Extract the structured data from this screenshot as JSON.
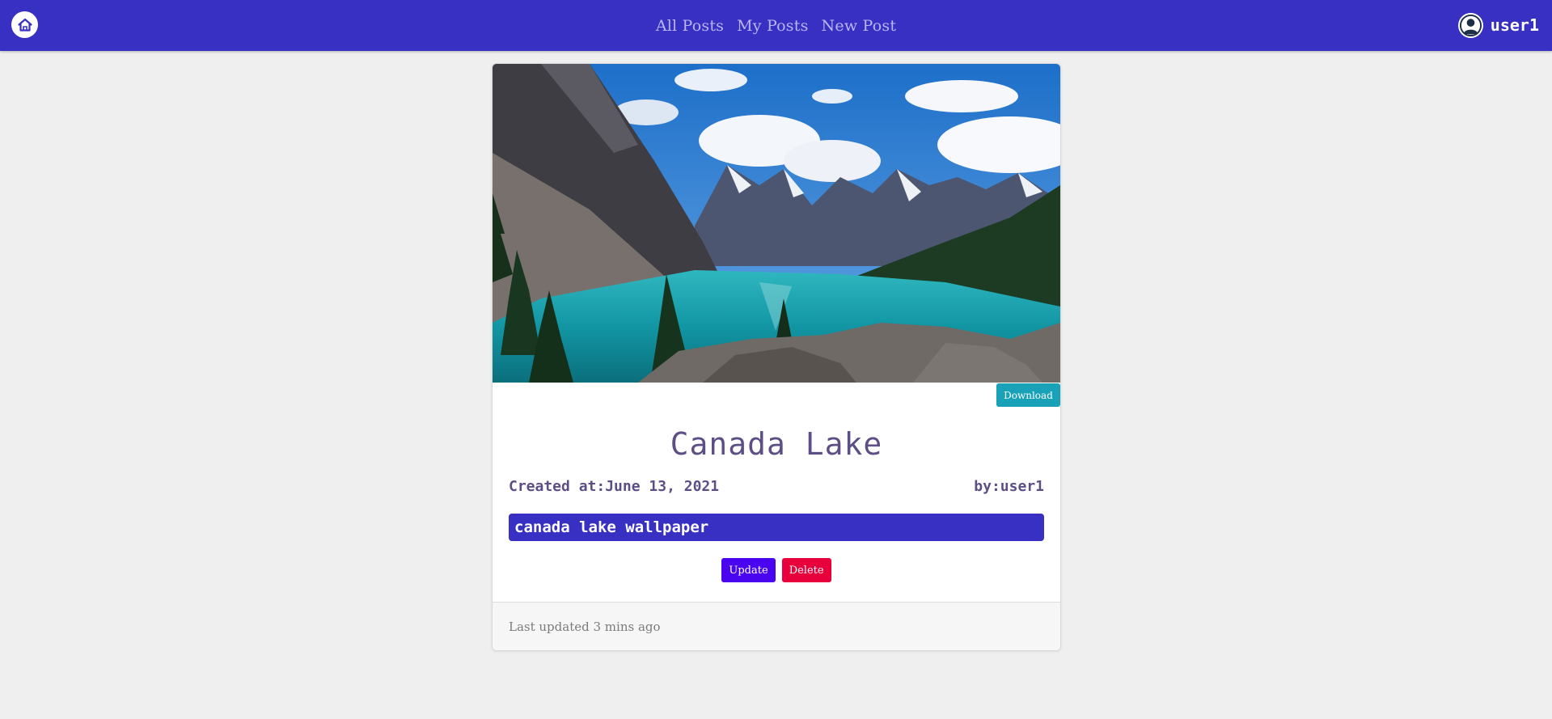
{
  "nav": {
    "home_icon": "home-icon",
    "links": [
      "All Posts",
      "My Posts",
      "New Post"
    ],
    "user_icon": "user-circle-icon",
    "username": "user1",
    "bar_color": "#3730c2"
  },
  "post": {
    "image_alt": "mountain lake landscape photo",
    "download_label": "Download",
    "title": "Canada Lake",
    "created_label": "Created at:June 13, 2021",
    "author_label": "by:user1",
    "description": "canada lake wallpaper",
    "update_label": "Update",
    "delete_label": "Delete",
    "footer_text": "Last updated 3 mins ago"
  },
  "colors": {
    "accent": "#3730c2",
    "update": "#4a05f0",
    "delete": "#e8003d",
    "download": "#19a1b8",
    "title_text": "#5d4f86"
  }
}
